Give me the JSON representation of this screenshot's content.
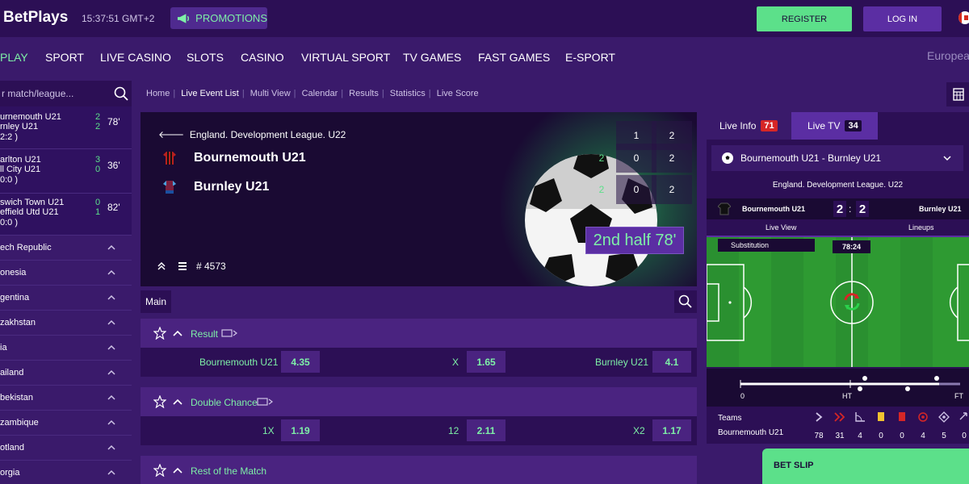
{
  "header": {
    "logo": "BetPlays",
    "clock": "15:37:51  GMT+2",
    "promotions_label": "PROMOTIONS",
    "register_label": "REGISTER",
    "login_label": "LOG IN",
    "accent_green": "#5ce08a",
    "purple": "#3a1a6b"
  },
  "nav": {
    "items": [
      "PLAY",
      "SPORT",
      "LIVE CASINO",
      "SLOTS",
      "CASINO",
      "VIRTUAL SPORT",
      "TV GAMES",
      "FAST GAMES",
      "E-SPORT"
    ],
    "active": "PLAY",
    "region": "Europea"
  },
  "sidebar": {
    "search_placeholder": "r match/league...",
    "live_matches": [
      {
        "home": "urnemouth U21",
        "away": "rnley U21",
        "home_score": "2",
        "away_score": "2",
        "minute": "78'",
        "extra": ""
      },
      {
        "home": "arlton U21",
        "away": "ll City U21",
        "home_score": "3",
        "away_score": "0",
        "minute": "36'",
        "extra": "0:0 )"
      },
      {
        "home": "swich Town U21",
        "away": "effield Utd U21",
        "home_score": "0",
        "away_score": "1",
        "minute": "82'",
        "extra": "0:0 )"
      }
    ],
    "first_extra": "2:2 )",
    "countries": [
      "ech Republic",
      "onesia",
      "gentina",
      "zakhstan",
      "ia",
      "ailand",
      "bekistan",
      "zambique",
      "otland",
      "orgia"
    ]
  },
  "breadcrumbs": [
    "Home",
    "Live Event List",
    "Multi View",
    "Calendar",
    "Results",
    "Statistics",
    "Live Score"
  ],
  "event": {
    "league": "England. Development League. U22",
    "home": "Bournemouth U21",
    "away": "Burnley U21",
    "period_headers": [
      "1",
      "2"
    ],
    "home_scores": [
      "2",
      "0",
      "2"
    ],
    "away_scores": [
      "2",
      "0",
      "2"
    ],
    "status": "2nd half 78'",
    "event_id": "# 4573"
  },
  "markets_bar": {
    "main_tab": "Main"
  },
  "markets": [
    {
      "title": "Result",
      "selections": [
        {
          "label": "Bournemouth U21",
          "odd": "4.35"
        },
        {
          "label": "X",
          "odd": "1.65"
        },
        {
          "label": "Burnley U21",
          "odd": "4.1"
        }
      ]
    },
    {
      "title": "Double Chance",
      "selections": [
        {
          "label": "1X",
          "odd": "1.19"
        },
        {
          "label": "12",
          "odd": "2.11"
        },
        {
          "label": "X2",
          "odd": "1.17"
        }
      ]
    },
    {
      "title": "Rest of the Match",
      "selections": []
    }
  ],
  "right": {
    "live_info_label": "Live Info",
    "live_info_count": "71",
    "live_tv_label": "Live TV",
    "live_tv_count": "34",
    "match_select": "Bournemouth U21 - Burnley U21",
    "league": "England. Development League. U22",
    "home": "Bournemouth U21",
    "away": "Burnley U21",
    "home_score": "2",
    "away_score": "2",
    "tab_live_view": "Live View",
    "tab_lineups": "Lineups",
    "event_label": "Substitution",
    "match_time": "78:24",
    "timeline_start": "0",
    "timeline_ht": "HT",
    "timeline_ft": "FT",
    "stats_header": "Teams",
    "stats_team": "Bournemouth U21",
    "stats_values": [
      "78",
      "31",
      "4",
      "0",
      "0",
      "4",
      "5",
      "0"
    ]
  },
  "betslip_label": "BET SLIP"
}
